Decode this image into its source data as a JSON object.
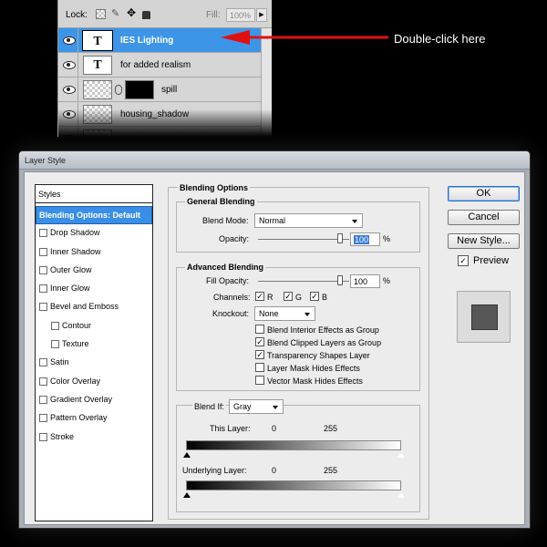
{
  "layers_panel": {
    "lock_label": "Lock:",
    "fill_label": "Fill:",
    "fill_value": "100%",
    "layers": [
      {
        "name": "IES Lighting",
        "thumb": "T",
        "selected": true
      },
      {
        "name": "for added realism",
        "thumb": "T",
        "selected": false
      },
      {
        "name": "spill",
        "thumb": "",
        "selected": false
      },
      {
        "name": "housing_shadow",
        "thumb": "",
        "selected": false
      }
    ]
  },
  "callout": {
    "text": "Double-click here",
    "arrow_color": "#e01010"
  },
  "dialog": {
    "title": "Layer Style",
    "styles_header": "Styles",
    "styles": [
      {
        "label": "Blending Options: Default",
        "active": true
      },
      {
        "label": "Drop Shadow"
      },
      {
        "label": "Inner Shadow"
      },
      {
        "label": "Outer Glow"
      },
      {
        "label": "Inner Glow"
      },
      {
        "label": "Bevel and Emboss"
      },
      {
        "label": "Contour",
        "indent": true
      },
      {
        "label": "Texture",
        "indent": true
      },
      {
        "label": "Satin"
      },
      {
        "label": "Color Overlay"
      },
      {
        "label": "Gradient Overlay"
      },
      {
        "label": "Pattern Overlay"
      },
      {
        "label": "Stroke"
      }
    ],
    "blending_options": {
      "title": "Blending Options",
      "general": {
        "title": "General Blending",
        "blend_mode_label": "Blend Mode:",
        "blend_mode_value": "Normal",
        "opacity_label": "Opacity:",
        "opacity_value": "100",
        "percent": "%"
      },
      "advanced": {
        "title": "Advanced Blending",
        "fill_opacity_label": "Fill Opacity:",
        "fill_opacity_value": "100",
        "percent": "%",
        "channels_label": "Channels:",
        "channel_r": "R",
        "channel_g": "G",
        "channel_b": "B",
        "knockout_label": "Knockout:",
        "knockout_value": "None",
        "options": [
          {
            "label": "Blend Interior Effects as Group",
            "checked": false
          },
          {
            "label": "Blend Clipped Layers as Group",
            "checked": true
          },
          {
            "label": "Transparency Shapes Layer",
            "checked": true
          },
          {
            "label": "Layer Mask Hides Effects",
            "checked": false
          },
          {
            "label": "Vector Mask Hides Effects",
            "checked": false
          }
        ]
      },
      "blend_if": {
        "label": "Blend If:",
        "value": "Gray",
        "this_layer_label": "This Layer:",
        "this_layer_min": "0",
        "this_layer_max": "255",
        "underlying_label": "Underlying Layer:",
        "underlying_min": "0",
        "underlying_max": "255"
      }
    },
    "buttons": {
      "ok": "OK",
      "cancel": "Cancel",
      "new_style": "New Style..."
    },
    "preview_label": "Preview",
    "preview_checked": true
  }
}
